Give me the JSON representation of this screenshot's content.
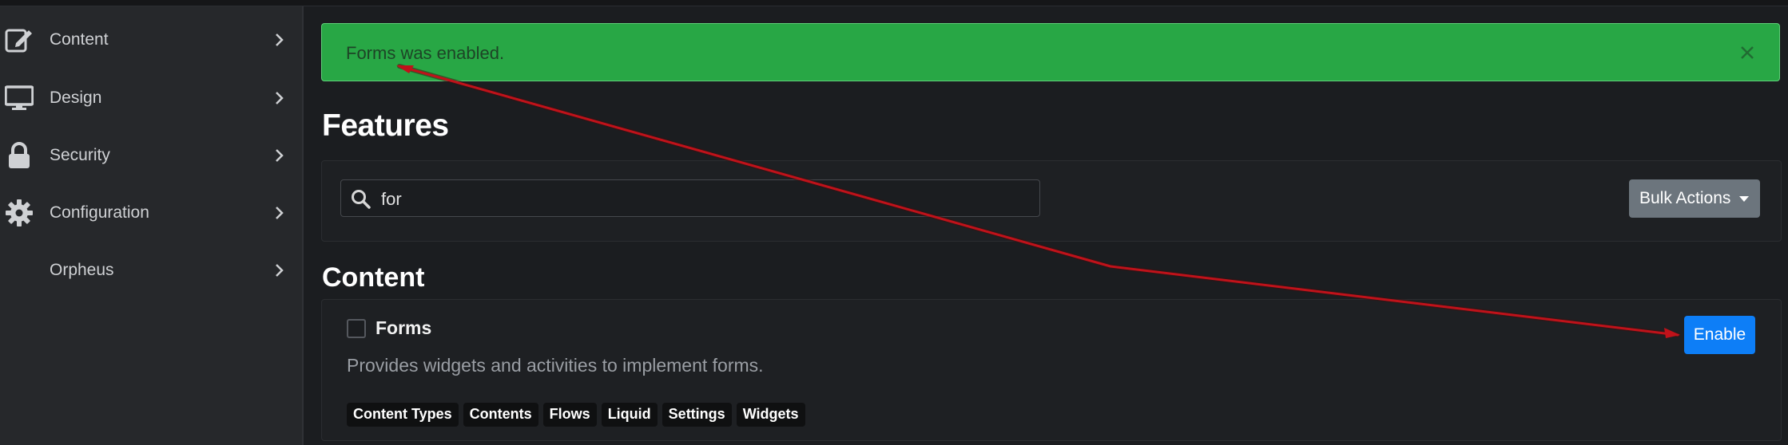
{
  "sidebar": {
    "items": [
      {
        "label": "Content",
        "icon": "edit-icon"
      },
      {
        "label": "Design",
        "icon": "monitor-icon"
      },
      {
        "label": "Security",
        "icon": "lock-icon"
      },
      {
        "label": "Configuration",
        "icon": "gear-icon"
      },
      {
        "label": "Orpheus",
        "icon": ""
      }
    ]
  },
  "alert": {
    "message": "Forms was enabled.",
    "close_symbol": "×"
  },
  "page": {
    "title": "Features"
  },
  "search": {
    "value": "for",
    "icon": "search-icon"
  },
  "bulk_actions": {
    "label": "Bulk Actions"
  },
  "section": {
    "title": "Content"
  },
  "feature": {
    "title": "Forms",
    "description": "Provides widgets and activities to implement forms.",
    "tags": [
      "Content Types",
      "Contents",
      "Flows",
      "Liquid",
      "Settings",
      "Widgets"
    ],
    "action_label": "Enable"
  },
  "colors": {
    "success": "#28a745",
    "primary": "#0d7ef7",
    "secondary": "#6c757d",
    "annotation_arrow": "#c0121a"
  }
}
